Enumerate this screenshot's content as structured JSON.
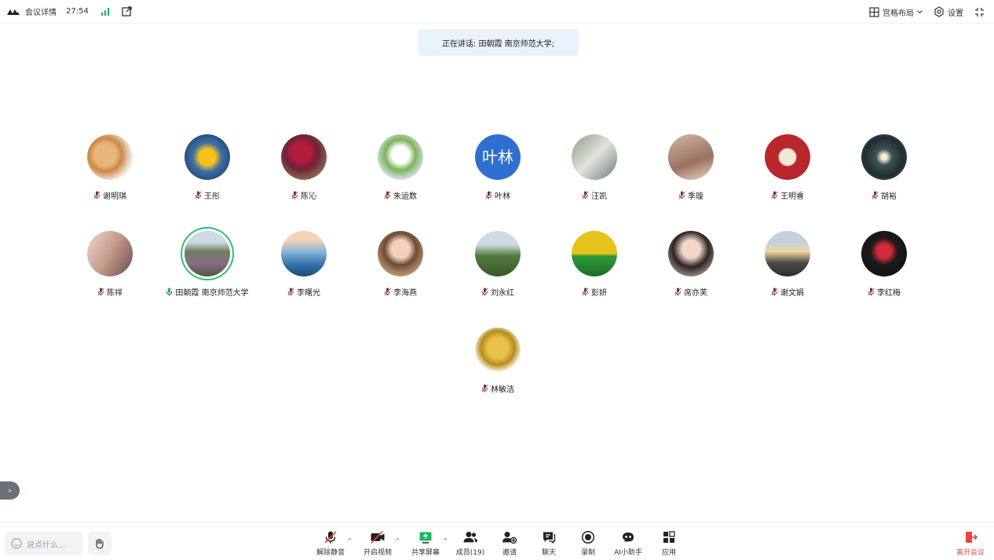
{
  "topbar": {
    "meeting_details": "会议详情",
    "timer": "27:54",
    "layout_label": "宫格布局",
    "settings_label": "设置"
  },
  "speaking_banner": "正在讲话: 田朝霞 南京师范大学;",
  "participants": [
    {
      "name": "谢明琪",
      "avatar": "cat-photo",
      "muted": true
    },
    {
      "name": "王彤",
      "avatar": "yellow-flower-photo",
      "muted": true
    },
    {
      "name": "陈沁",
      "avatar": "red-roses-photo",
      "muted": true
    },
    {
      "name": "朱运数",
      "avatar": "white-tulips-photo",
      "muted": true
    },
    {
      "name": "叶林",
      "avatar_text": "叶林",
      "avatar_color": "#2f6fd1",
      "muted": true
    },
    {
      "name": "汪凯",
      "avatar": "cup-photo",
      "muted": true
    },
    {
      "name": "季璇",
      "avatar": "coffee-photo",
      "muted": true
    },
    {
      "name": "王明睿",
      "avatar": "red-seal-photo",
      "muted": true
    },
    {
      "name": "胡裕",
      "avatar": "star-trails-photo",
      "muted": true
    },
    {
      "name": "陈祥",
      "avatar": "portrait-painting-photo",
      "muted": true
    },
    {
      "name": "田朝霞 南京师范大学",
      "avatar": "temple-person-photo",
      "muted": false,
      "speaking": true
    },
    {
      "name": "李曙光",
      "avatar": "sea-clouds-photo",
      "muted": true
    },
    {
      "name": "李海燕",
      "avatar": "woman-portrait-photo",
      "muted": true
    },
    {
      "name": "刘永红",
      "avatar": "trees-photo",
      "muted": true
    },
    {
      "name": "彭妍",
      "avatar": "yellow-green-photo",
      "muted": true
    },
    {
      "name": "席亦芙",
      "avatar": "woman-hand-photo",
      "muted": true
    },
    {
      "name": "谢文娟",
      "avatar": "sunset-photo",
      "muted": true
    },
    {
      "name": "李红梅",
      "avatar": "red-flower-dark-photo",
      "muted": true
    },
    {
      "name": "林敏洁",
      "avatar": "golden-statue-photo",
      "muted": true
    }
  ],
  "bottombar": {
    "say_placeholder": "说点什么...",
    "tools": {
      "unmute": "解除静音",
      "video": "开启视频",
      "share": "共享屏幕",
      "members": "成员(19)",
      "invite": "邀请",
      "chat": "聊天",
      "record": "录制",
      "ai": "AI小助手",
      "apps": "应用"
    },
    "leave": "离开会议"
  },
  "colors": {
    "accent_green": "#1fb563",
    "leave_red": "#e8453c",
    "banner_bg": "#eaf2fe"
  }
}
